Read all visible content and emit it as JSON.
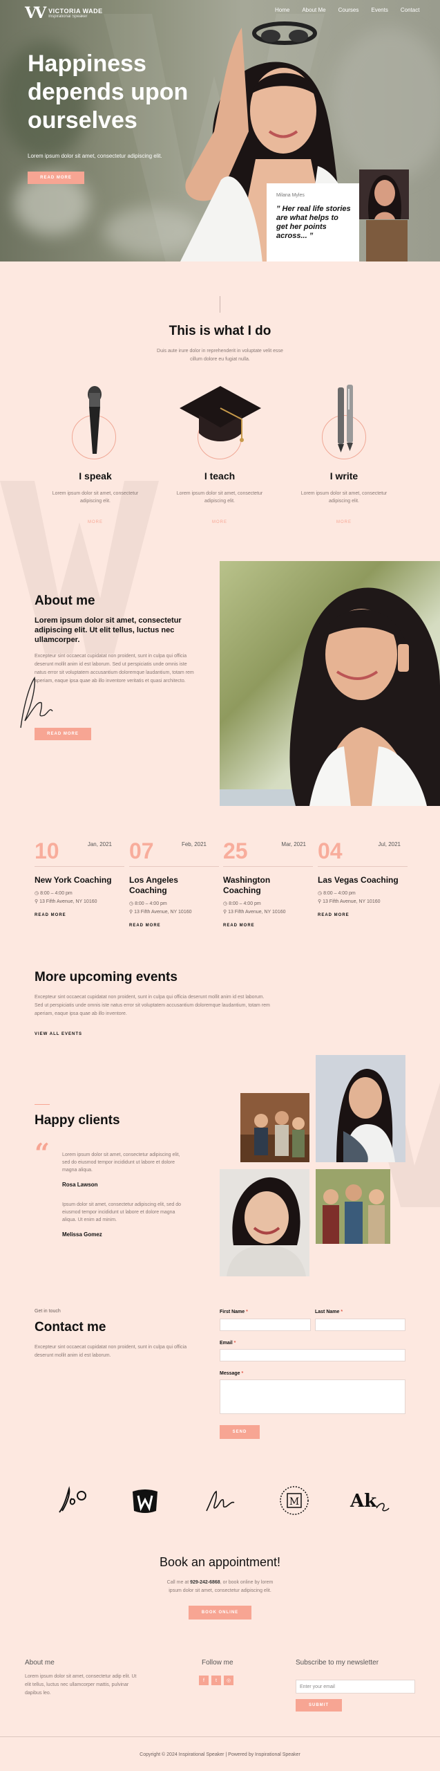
{
  "brand": {
    "name": "VICTORIA WADE",
    "tagline": "Inspirational Speaker"
  },
  "nav": [
    "Home",
    "About Me",
    "Courses",
    "Events",
    "Contact"
  ],
  "hero": {
    "title": "Happiness depends upon ourselves",
    "subtitle": "Lorem ipsum dolor sit amet, consectetur adipiscing elit.",
    "button": "READ MORE",
    "quote_author": "Milana Myles",
    "quote": "” Her real life stories are what helps to get her points across... ”"
  },
  "services": {
    "title": "This is what I do",
    "subtitle_1": "Duis aute irure dolor in reprehenderit in voluptate velit esse",
    "subtitle_2": "cillum dolore eu fugiat nulla.",
    "items": [
      {
        "title": "I speak",
        "text_1": "Lorem ipsum dolor sit amet, consectetur",
        "text_2": "adipiscing elit.",
        "link": "MORE",
        "icon": "microphone-icon"
      },
      {
        "title": "I teach",
        "text_1": "Lorem ipsum dolor sit amet, consectetur",
        "text_2": "adipiscing elit.",
        "link": "MORE",
        "icon": "graduation-cap-icon"
      },
      {
        "title": "I write",
        "text_1": "Lorem ipsum dolor sit amet, consectetur",
        "text_2": "adipiscing elit.",
        "link": "MORE",
        "icon": "pen-icon"
      }
    ]
  },
  "about": {
    "title": "About me",
    "lead": "Lorem ipsum dolor sit amet, consectetur adipiscing elit. Ut elit tellus, luctus nec ullamcorper.",
    "body": "Excepteur sint occaecat cupidatat non proident, sunt in culpa qui officia deserunt mollit anim id est laborum. Sed ut perspiciatis unde omnis iste natus error sit voluptatem accusantium doloremque laudantium, totam rem aperiam, eaque ipsa quae ab illo inventore veritatis et quasi architecto.",
    "button": "READ MORE"
  },
  "events": [
    {
      "day": "10",
      "date": "Jan, 2021",
      "title": "New York Coaching",
      "time": "8:00 – 4:00 pm",
      "address": "13 Fifth Avenue, NY 10160",
      "link": "READ MORE"
    },
    {
      "day": "07",
      "date": "Feb, 2021",
      "title": "Los Angeles Coaching",
      "time": "8:00 – 4:00 pm",
      "address": "13 Fifth Avenue, NY 10160",
      "link": "READ MORE"
    },
    {
      "day": "25",
      "date": "Mar, 2021",
      "title": "Washington Coaching",
      "time": "8:00 – 4:00 pm",
      "address": "13 Fifth Avenue, NY 10160",
      "link": "READ MORE"
    },
    {
      "day": "04",
      "date": "Jul, 2021",
      "title": "Las Vegas Coaching",
      "time": "8:00 – 4:00 pm",
      "address": "13 Fifth Avenue, NY 10160",
      "link": "READ MORE"
    }
  ],
  "more_events": {
    "title": "More upcoming events",
    "body": "Excepteur sint occaecat cupidatat non proident, sunt in culpa qui officia deserunt mollit anim id est laborum. Sed ut perspiciatis unde omnis iste natus error sit voluptatem accusantium doloremque laudantium, totam rem aperiam, eaque ipsa quae ab illo inventore.",
    "link": "VIEW ALL EVENTS"
  },
  "clients": {
    "title": "Happy clients",
    "testimonials": [
      {
        "text": "Lorem ipsum dolor sit amet, consectetur adipiscing elit, sed do eiusmod tempor incididunt ut labore et dolore magna aliqua.",
        "name": "Rosa Lawson"
      },
      {
        "text": "Ipsum dolor sit amet, consectetur adipiscing elit, sed do eiusmod tempor incididunt ut labore et dolore magna aliqua. Ut enim ad minim.",
        "name": "Melissa Gomez"
      }
    ]
  },
  "contact": {
    "eyebrow": "Get in touch",
    "title": "Contact me",
    "body": "Excepteur sint occaecat cupidatat non proident, sunt in culpa qui officia deserunt mollit anim id est laborum.",
    "first_name": "First Name",
    "last_name": "Last Name",
    "email": "Email",
    "message": "Message",
    "required": "*",
    "button": "SEND"
  },
  "appointment": {
    "title": "Book an appointment!",
    "line1_a": "Call me at ",
    "phone": "929-242-6868",
    "line1_b": ", or book online by lorem",
    "line2": "ipsum dolor sit amet, consectetur adipiscing elit.",
    "button": "BOOK ONLINE"
  },
  "footer": {
    "about_title": "About me",
    "about_text": "Lorem ipsum dolor sit amet, consectetur adip elit. Ut elit tellus, luctus nec ullamcorper mattis, pulvinar dapibus leo.",
    "follow_title": "Follow me",
    "newsletter_title": "Subscribe to my newsletter",
    "email_placeholder": "Enter your email",
    "subscribe": "SUBMIT",
    "copyright": "Copyright © 2024 Inspirational Speaker | Powered by Inspirational Speaker"
  },
  "colors": {
    "accent": "#f7a593",
    "background": "#fde8e0"
  }
}
